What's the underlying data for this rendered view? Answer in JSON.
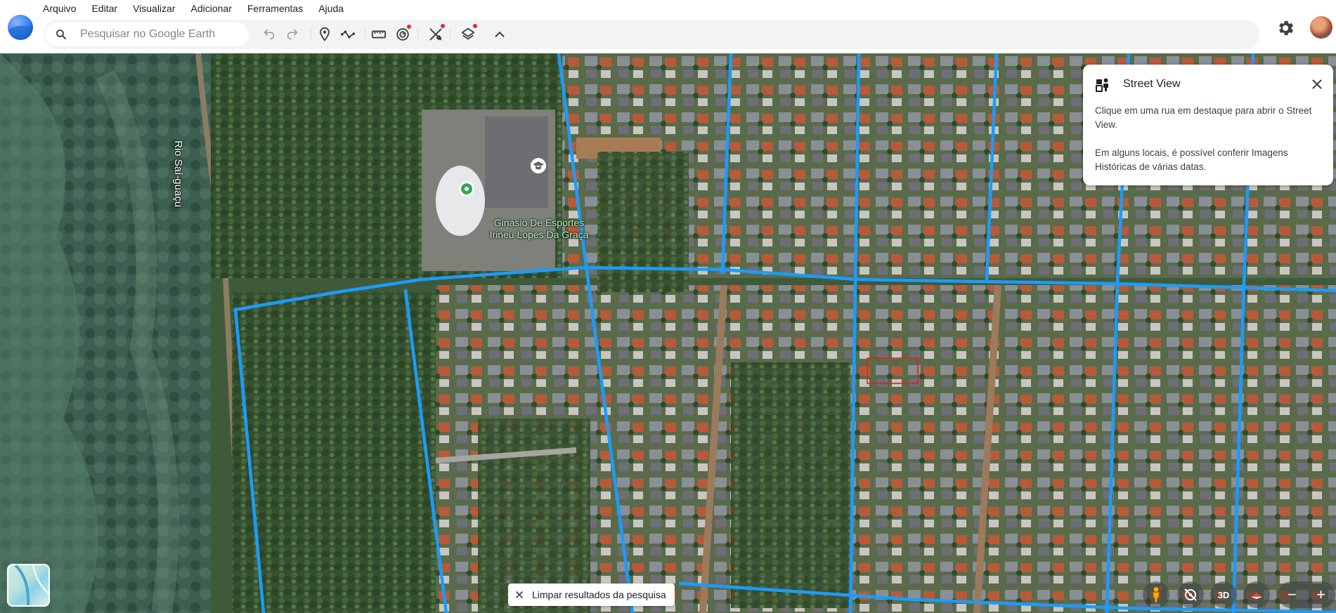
{
  "menu": {
    "items": [
      "Arquivo",
      "Editar",
      "Visualizar",
      "Adicionar",
      "Ferramentas",
      "Ajuda"
    ]
  },
  "toolbar": {
    "search_placeholder": "Pesquisar no Google Earth",
    "icons": [
      "search-icon",
      "undo-icon",
      "redo-icon",
      "placemark-icon",
      "path-icon",
      "ruler-icon",
      "timelapse-icon",
      "tools-icon",
      "layers-icon",
      "collapse-icon",
      "settings-icon"
    ]
  },
  "map": {
    "place_label_line1": "Ginasio De Esportes",
    "place_label_line2": "Irineu Lopes Da Graça",
    "river_label": "Rio Saí-guaçu"
  },
  "street_view": {
    "title": "Street View",
    "text1": "Clique em uma rua em destaque para abrir o Street View.",
    "text2": "Em alguns locais, é possível conferir Imagens Históricas de várias datas."
  },
  "bottom": {
    "clear_label": "Limpar resultados da pesquisa",
    "view_3d_label": "3D",
    "zoom_out": "−",
    "zoom_in": "+"
  },
  "colors": {
    "street_view_lines": "#1a9cff",
    "vegetation": "#3e5a38",
    "accent_red": "#d93025"
  }
}
